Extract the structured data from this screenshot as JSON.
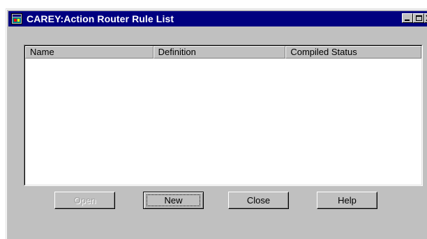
{
  "window": {
    "title": "CAREY:Action Router Rule List",
    "icon": "app-window-icon",
    "controls": [
      "minimize-icon",
      "maximize-icon",
      "close-icon"
    ]
  },
  "list": {
    "columns": [
      "Name",
      "Definition",
      "Compiled Status"
    ],
    "rows": []
  },
  "buttons": {
    "open": "Open",
    "new": "New",
    "close": "Close",
    "help": "Help"
  },
  "colors": {
    "titlebar": "#000080",
    "face": "#c0c0c0",
    "disabled_text": "#a0a0a0"
  }
}
